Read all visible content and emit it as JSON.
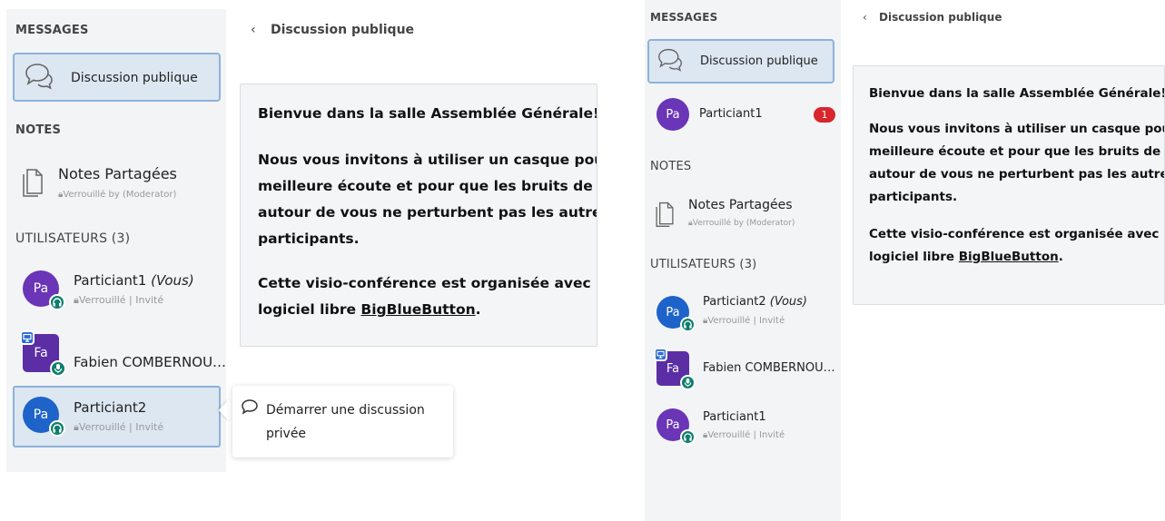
{
  "left": {
    "sidebar": {
      "messages_header": "MESSAGES",
      "public_chat_label": "Discussion publique",
      "notes_header": "NOTES",
      "notes_title": "Notes Partagées",
      "notes_status": "Verrouillé by (Moderator)",
      "users_header": "UTILISATEURS (3)",
      "users": [
        {
          "initials": "Pa",
          "name": "Particiant1",
          "you": "(Vous)",
          "status": "Verrouillé | Invité",
          "color": "#6a35b6"
        },
        {
          "initials": "Fa",
          "name": "Fabien COMBERNOU…",
          "you": "",
          "status": "",
          "color": "#5b2ea6"
        },
        {
          "initials": "Pa",
          "name": "Particiant2",
          "you": "",
          "status": "Verrouillé | Invité",
          "color": "#1e63c9"
        }
      ]
    },
    "chat_header": "Discussion publique",
    "welcome": {
      "line1_prefix": "Bienvue dans la salle ",
      "room": "Assemblée Générale",
      "line1_suffix": "!",
      "para2": [
        "Nous vous invitons à utiliser un casque pour une",
        "meilleure écoute et pour que les bruits de fond",
        "autour de vous ne perturbent pas les autres",
        "participants."
      ],
      "para3_line1": "Cette visio-conférence est organisée avec le",
      "para3_line2_prefix": "logiciel libre ",
      "link": "BigBlueButton",
      "para3_line2_suffix": "."
    },
    "popup": {
      "line1": "Démarrer une discussion",
      "line2": "privée"
    }
  },
  "right": {
    "sidebar": {
      "messages_header": "MESSAGES",
      "public_chat_label": "Discussion publique",
      "private_chat": {
        "initials": "Pa",
        "name": "Particiant1",
        "unread": "1",
        "color": "#6a35b6"
      },
      "notes_header": "NOTES",
      "notes_title": "Notes Partagées",
      "notes_status": "Verrouillé by (Moderator)",
      "users_header": "UTILISATEURS (3)",
      "users": [
        {
          "initials": "Pa",
          "name": "Particiant2",
          "you": "(Vous)",
          "status": "Verrouillé | Invité",
          "color": "#1e63c9"
        },
        {
          "initials": "Fa",
          "name": "Fabien COMBERNOU…",
          "you": "",
          "status": "",
          "color": "#5b2ea6"
        },
        {
          "initials": "Pa",
          "name": "Particiant1",
          "you": "",
          "status": "Verrouillé | Invité",
          "color": "#6a35b6"
        }
      ]
    },
    "chat_header": "Discussion publique",
    "welcome": {
      "line1_prefix": "Bienvue dans la salle ",
      "room": "Assemblée Générale",
      "line1_suffix": "!",
      "para2": [
        "Nous vous invitons à utiliser un casque pour une",
        "meilleure écoute et pour que les bruits de fond",
        "autour de vous ne perturbent pas les autres",
        "participants."
      ],
      "para3_line1": "Cette visio-conférence est organisée avec le",
      "para3_line2_prefix": "logiciel libre ",
      "link": "BigBlueButton",
      "para3_line2_suffix": "."
    }
  }
}
